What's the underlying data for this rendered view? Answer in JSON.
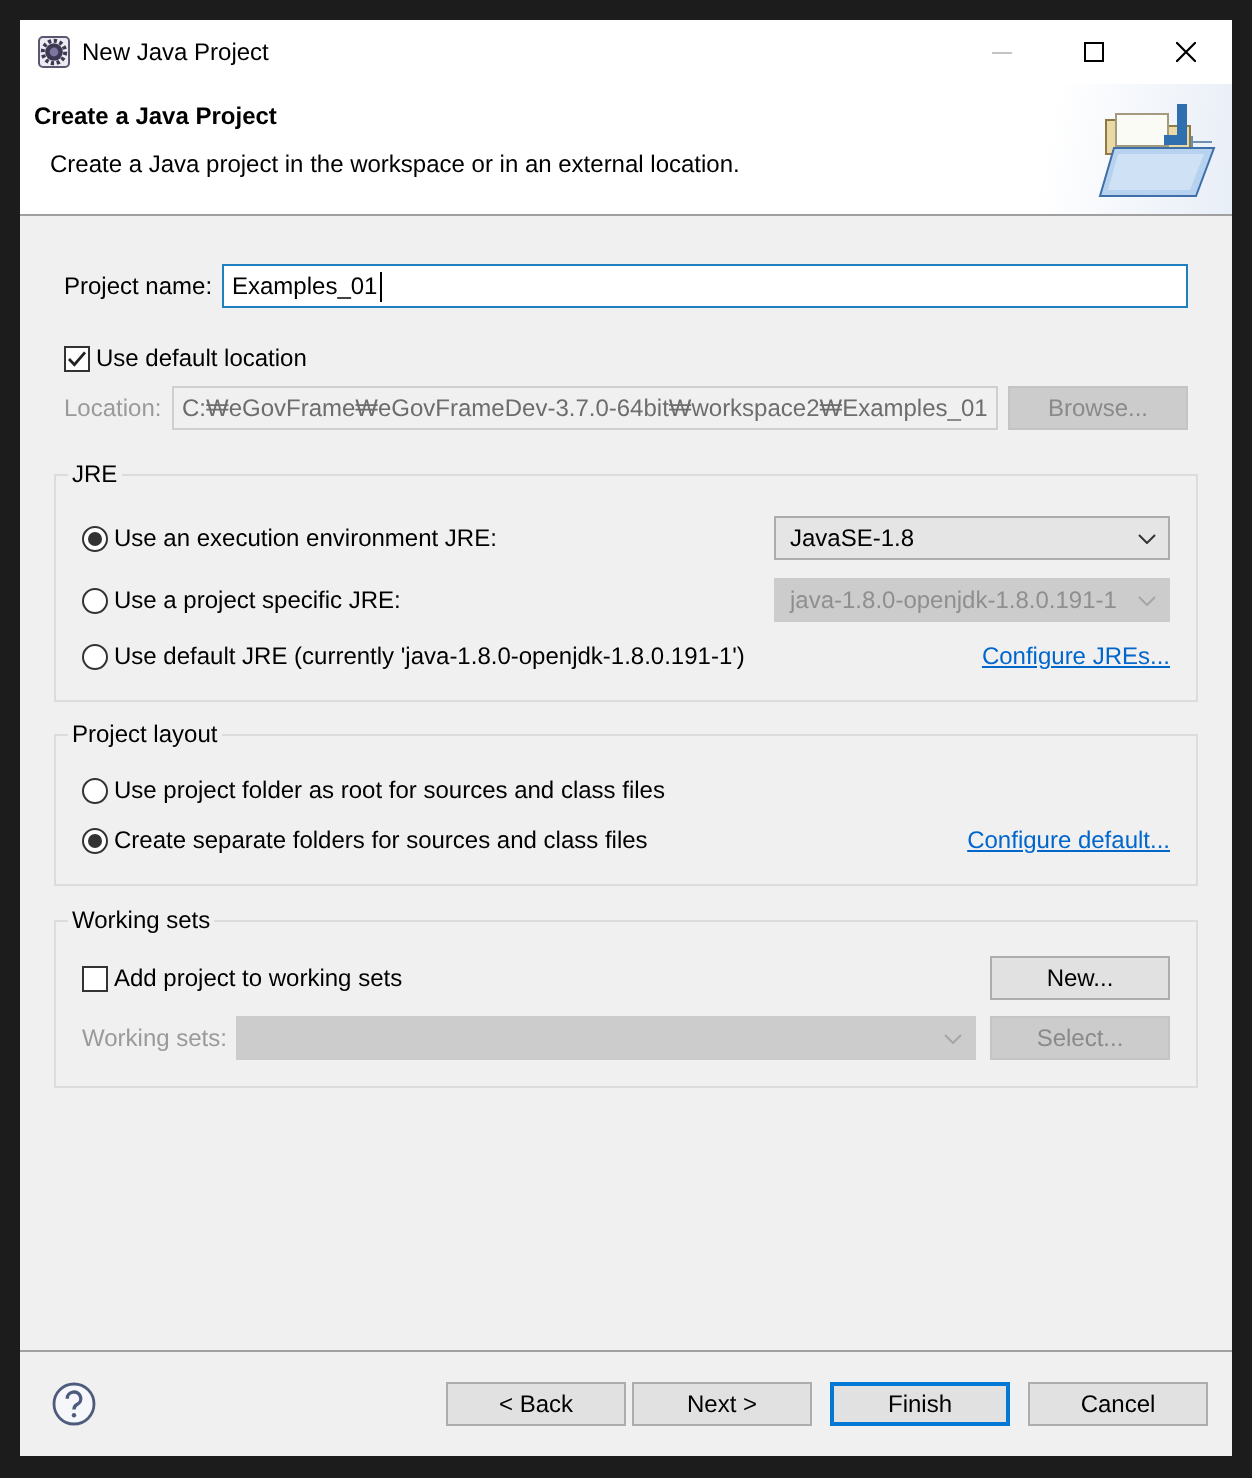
{
  "window": {
    "title": "New Java Project",
    "minimize_disabled": true
  },
  "header": {
    "title": "Create a Java Project",
    "description": "Create a Java project in the workspace or in an external location."
  },
  "project_name": {
    "label": "Project name:",
    "value": "Examples_01",
    "focused": true
  },
  "default_location": {
    "label": "Use default location",
    "checked": true
  },
  "location": {
    "label": "Location:",
    "value": "C:₩eGovFrame₩eGovFrameDev-3.7.0-64bit₩workspace2₩Examples_01",
    "disabled": true,
    "button": {
      "label": "Browse...",
      "disabled": true
    }
  },
  "jre": {
    "title": "JRE",
    "options": [
      {
        "label": "Use an execution environment JRE:",
        "selected": true,
        "combo": {
          "value": "JavaSE-1.8",
          "disabled": false
        }
      },
      {
        "label": "Use a project specific JRE:",
        "selected": false,
        "combo": {
          "value": "java-1.8.0-openjdk-1.8.0.191-1",
          "disabled": true
        }
      },
      {
        "label": "Use default JRE (currently 'java-1.8.0-openjdk-1.8.0.191-1')",
        "selected": false,
        "link": "Configure JREs..."
      }
    ]
  },
  "project_layout": {
    "title": "Project layout",
    "options": [
      {
        "label": "Use project folder as root for sources and class files",
        "selected": false
      },
      {
        "label": "Create separate folders for sources and class files",
        "selected": true,
        "link": "Configure default..."
      }
    ]
  },
  "working_sets": {
    "title": "Working sets",
    "add": {
      "label": "Add project to working sets",
      "checked": false
    },
    "new_button": {
      "label": "New...",
      "disabled": false
    },
    "field": {
      "label": "Working sets:",
      "disabled": true
    },
    "select_button": {
      "label": "Select...",
      "disabled": true
    }
  },
  "buttons": [
    {
      "label": "< Back",
      "default": false
    },
    {
      "label": "Next >",
      "default": false
    },
    {
      "label": "Finish",
      "default": true
    },
    {
      "label": "Cancel",
      "default": false
    }
  ]
}
